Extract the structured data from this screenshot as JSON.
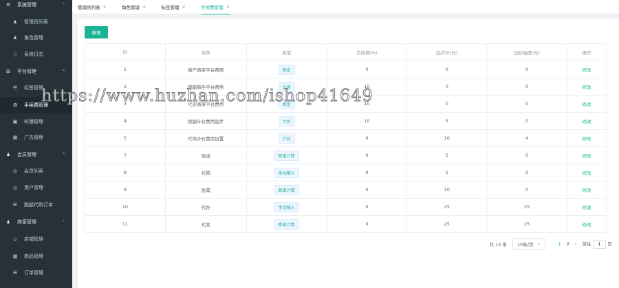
{
  "sidebar": {
    "items": [
      {
        "label": "系统管理",
        "type": "group",
        "icon": "gear-icon"
      },
      {
        "label": "管理员列表",
        "type": "sub",
        "icon": "user-icon"
      },
      {
        "label": "角色管理",
        "type": "sub",
        "icon": "user-icon"
      },
      {
        "label": "系统日志",
        "type": "sub",
        "icon": "document-icon"
      },
      {
        "label": "平台管理",
        "type": "group",
        "icon": "grid-icon"
      },
      {
        "label": "标签管理",
        "type": "sub",
        "icon": "list-icon"
      },
      {
        "label": "手续费管理",
        "type": "sub",
        "icon": "gear-icon",
        "active": true
      },
      {
        "label": "轮播管理",
        "type": "sub",
        "icon": "image-icon"
      },
      {
        "label": "广告管理",
        "type": "sub",
        "icon": "picture-icon"
      },
      {
        "label": "会员管理",
        "type": "group",
        "icon": "user-icon"
      },
      {
        "label": "会员列表",
        "type": "sub",
        "icon": "user-circle-icon"
      },
      {
        "label": "用户管理",
        "type": "sub",
        "icon": "user-circle-icon"
      },
      {
        "label": "跑腿代购订单",
        "type": "sub",
        "icon": "list-icon"
      },
      {
        "label": "商家管理",
        "type": "group",
        "icon": "user-icon"
      },
      {
        "label": "店铺管理",
        "type": "sub",
        "icon": "home-icon"
      },
      {
        "label": "商品管理",
        "type": "sub",
        "icon": "picture-icon"
      },
      {
        "label": "订单管理",
        "type": "sub",
        "icon": "list-icon"
      }
    ]
  },
  "tabs": [
    {
      "label": "管理员列表"
    },
    {
      "label": "角色管理"
    },
    {
      "label": "标签管理"
    },
    {
      "label": "手续费管理",
      "active": true
    }
  ],
  "toolbar": {
    "add_label": "新增"
  },
  "table": {
    "headers": [
      "ID",
      "名称",
      "类型",
      "手续费(%)",
      "起步价(元)",
      "加价幅度(元)",
      "操作"
    ],
    "rows": [
      [
        "1",
        "商户商家平台费用",
        "固定",
        "0",
        "0",
        "0",
        "修改"
      ],
      [
        "2",
        "跑腿骑手平台费用",
        "比例",
        "10",
        "0",
        "0",
        "修改"
      ],
      [
        "3",
        "代买商家平台费用",
        "固定",
        "10",
        "0",
        "0",
        "修改"
      ],
      [
        "4",
        "跑腿计价费用起步",
        "计价",
        "10",
        "5",
        "0",
        "修改"
      ],
      [
        "5",
        "代驾计价费用设置",
        "计价",
        "0",
        "10",
        "4",
        "修改"
      ],
      [
        "7",
        "取送",
        "距离计算",
        "0",
        "5",
        "0",
        "修改"
      ],
      [
        "8",
        "代购",
        "手动输入",
        "0",
        "5",
        "0",
        "修改"
      ],
      [
        "9",
        "急需",
        "距离计算",
        "0",
        "10",
        "0",
        "修改"
      ],
      [
        "10",
        "代办",
        "手动输入",
        "0",
        "25",
        "25",
        "修改"
      ],
      [
        "11",
        "代发",
        "距离计算",
        "0",
        "25",
        "25",
        "修改"
      ]
    ]
  },
  "pagination": {
    "total": "共 14 条",
    "page_size": "10条/页",
    "pages": [
      "1",
      "2"
    ],
    "current": "1",
    "goto_label": "前往",
    "goto_value": "1",
    "page_suffix": "页"
  },
  "watermark": "https://www.huzhan.com/ishop41649"
}
